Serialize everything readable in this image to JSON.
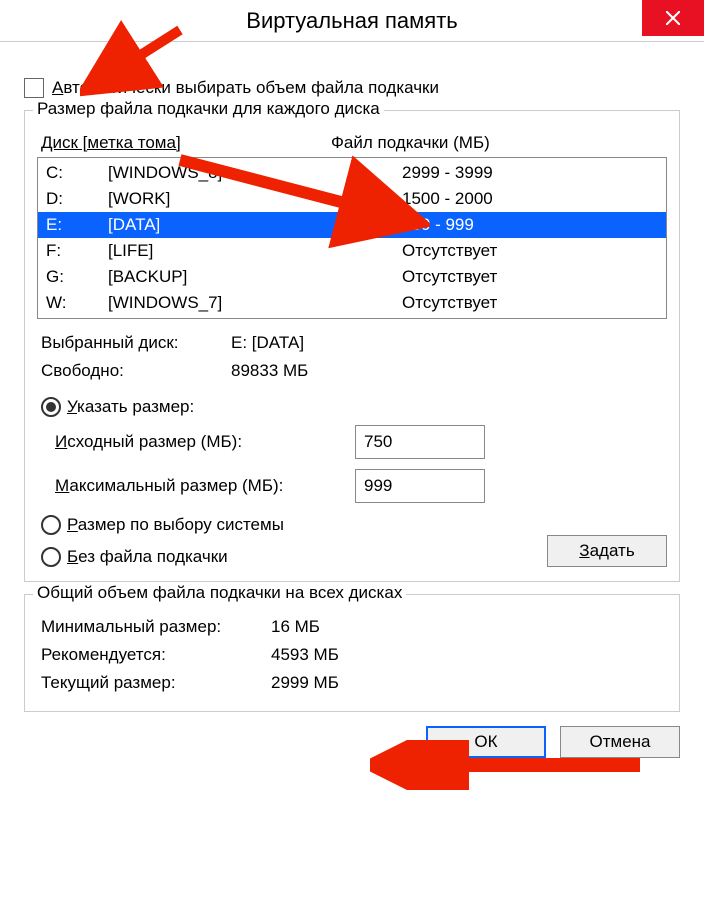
{
  "title": "Виртуальная память",
  "auto_checkbox_label": "Автоматически выбирать объем файла подкачки",
  "group_drives_label": "Размер файла подкачки для каждого диска",
  "header_drive": "Диск [метка тома]",
  "header_paging": "Файл подкачки (МБ)",
  "drives": [
    {
      "letter": "C:",
      "label": "[WINDOWS_8]",
      "size": "2999 - 3999",
      "selected": false
    },
    {
      "letter": "D:",
      "label": "[WORK]",
      "size": "1500 - 2000",
      "selected": false
    },
    {
      "letter": "E:",
      "label": "[DATA]",
      "size": "750 - 999",
      "selected": true
    },
    {
      "letter": "F:",
      "label": "[LIFE]",
      "size": "Отсутствует",
      "selected": false
    },
    {
      "letter": "G:",
      "label": "[BACKUP]",
      "size": "Отсутствует",
      "selected": false
    },
    {
      "letter": "W:",
      "label": "[WINDOWS_7]",
      "size": "Отсутствует",
      "selected": false
    }
  ],
  "selected_label": "Выбранный диск:",
  "selected_value": "E:  [DATA]",
  "free_label": "Свободно:",
  "free_value": "89833 МБ",
  "radio_custom": "Указать размер:",
  "initial_size_label": "Исходный размер (МБ):",
  "initial_size_value": "750",
  "max_size_label": "Максимальный размер (МБ):",
  "max_size_value": "999",
  "radio_system": "Размер по выбору системы",
  "radio_none": "Без файла подкачки",
  "set_button": "Задать",
  "group_totals_label": "Общий объем файла подкачки на всех дисках",
  "min_label": "Минимальный размер:",
  "min_value": "16 МБ",
  "rec_label": "Рекомендуется:",
  "rec_value": "4593 МБ",
  "cur_label": "Текущий размер:",
  "cur_value": "2999 МБ",
  "ok_button": "ОК",
  "cancel_button": "Отмена"
}
